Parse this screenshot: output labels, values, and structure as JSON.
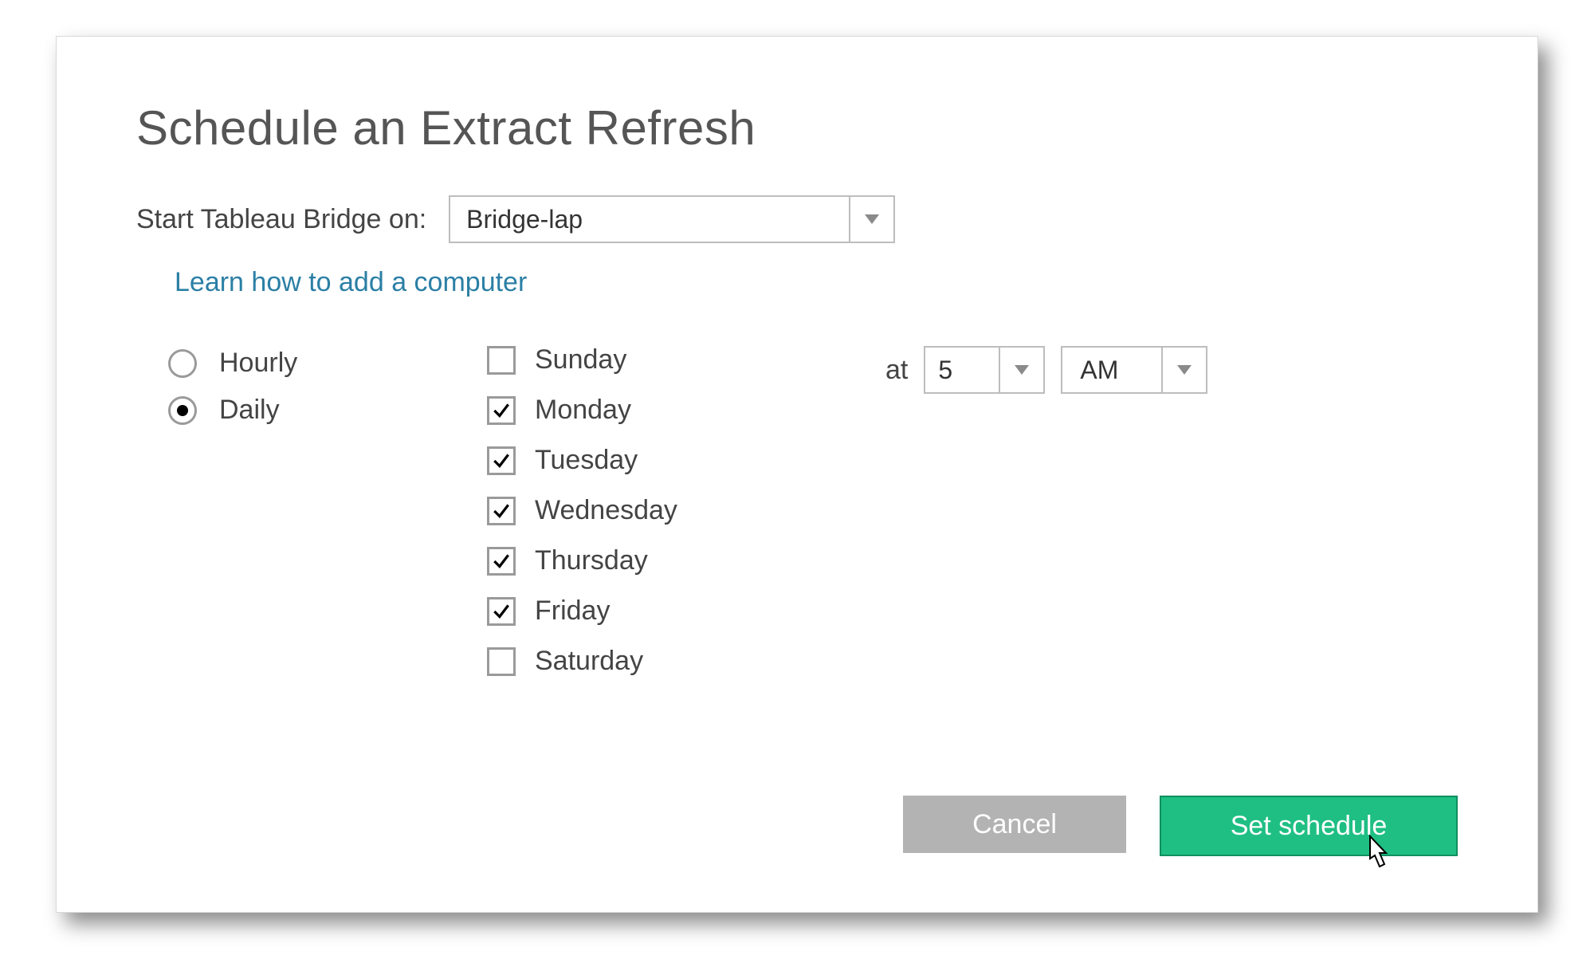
{
  "dialog": {
    "title": "Schedule an Extract Refresh",
    "start_label": "Start Tableau Bridge on:",
    "bridge_select": {
      "value": "Bridge-lap"
    },
    "learn_link": "Learn how to add a computer",
    "frequency": {
      "options": [
        {
          "label": "Hourly",
          "checked": false
        },
        {
          "label": "Daily",
          "checked": true
        }
      ]
    },
    "days": [
      {
        "label": "Sunday",
        "checked": false
      },
      {
        "label": "Monday",
        "checked": true
      },
      {
        "label": "Tuesday",
        "checked": true
      },
      {
        "label": "Wednesday",
        "checked": true
      },
      {
        "label": "Thursday",
        "checked": true
      },
      {
        "label": "Friday",
        "checked": true
      },
      {
        "label": "Saturday",
        "checked": false
      }
    ],
    "time": {
      "at_label": "at",
      "hour": "5",
      "ampm": "AM"
    },
    "buttons": {
      "cancel": "Cancel",
      "primary": "Set schedule"
    }
  }
}
